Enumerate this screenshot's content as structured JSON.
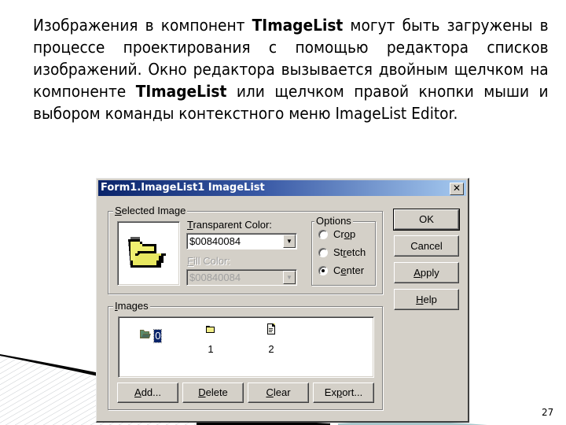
{
  "slide": {
    "paragraph": [
      {
        "text": "Изображения в компонент ",
        "bold": false
      },
      {
        "text": "TImageList",
        "bold": true
      },
      {
        "text": " могут быть загружены в процессе проектирования с помощью редактора списков изображений. Окно редактора вызывается двойным щелчком на компоненте ",
        "bold": false
      },
      {
        "text": "TImageList",
        "bold": true
      },
      {
        "text": " или щелчком правой кнопки мыши и выбором команды контекстного меню ImageList Editor.",
        "bold": false
      }
    ],
    "page_number": "27"
  },
  "dialog": {
    "title": "Form1.ImageList1 ImageList",
    "close_glyph": "✕",
    "selected_image": {
      "group_label_accel": "S",
      "group_label_rest": "elected Image",
      "preview_icon": "open-folder-icon",
      "transparent_color_label_accel": "T",
      "transparent_color_label_rest": "ransparent Color:",
      "transparent_color_value": "$00840084",
      "fill_color_label_accel": "F",
      "fill_color_label_rest": "ill Color:",
      "fill_color_value": "$00840084",
      "fill_color_enabled": false
    },
    "options": {
      "group_label": "Options",
      "items": [
        {
          "pre": "Cr",
          "accel": "o",
          "post": "p",
          "checked": false
        },
        {
          "pre": "St",
          "accel": "r",
          "post": "etch",
          "checked": false
        },
        {
          "pre": "C",
          "accel": "e",
          "post": "nter",
          "checked": true
        }
      ]
    },
    "buttons": [
      {
        "pre": "",
        "accel": "",
        "post": "OK",
        "default": true
      },
      {
        "pre": "",
        "accel": "",
        "post": "Cancel",
        "default": false
      },
      {
        "pre": "",
        "accel": "A",
        "post": "pply",
        "default": false
      },
      {
        "pre": "",
        "accel": "H",
        "post": "elp",
        "default": false
      }
    ],
    "images": {
      "group_label_accel": "I",
      "group_label_rest": "mages",
      "items": [
        {
          "label": "0",
          "icon": "open-folder-icon",
          "selected": true
        },
        {
          "label": "1",
          "icon": "closed-folder-icon",
          "selected": false
        },
        {
          "label": "2",
          "icon": "document-icon",
          "selected": false
        }
      ],
      "buttons": [
        {
          "pre": "",
          "accel": "A",
          "post": "dd..."
        },
        {
          "pre": "",
          "accel": "D",
          "post": "elete"
        },
        {
          "pre": "",
          "accel": "C",
          "post": "lear"
        },
        {
          "pre": "Ex",
          "accel": "p",
          "post": "ort..."
        }
      ]
    }
  }
}
